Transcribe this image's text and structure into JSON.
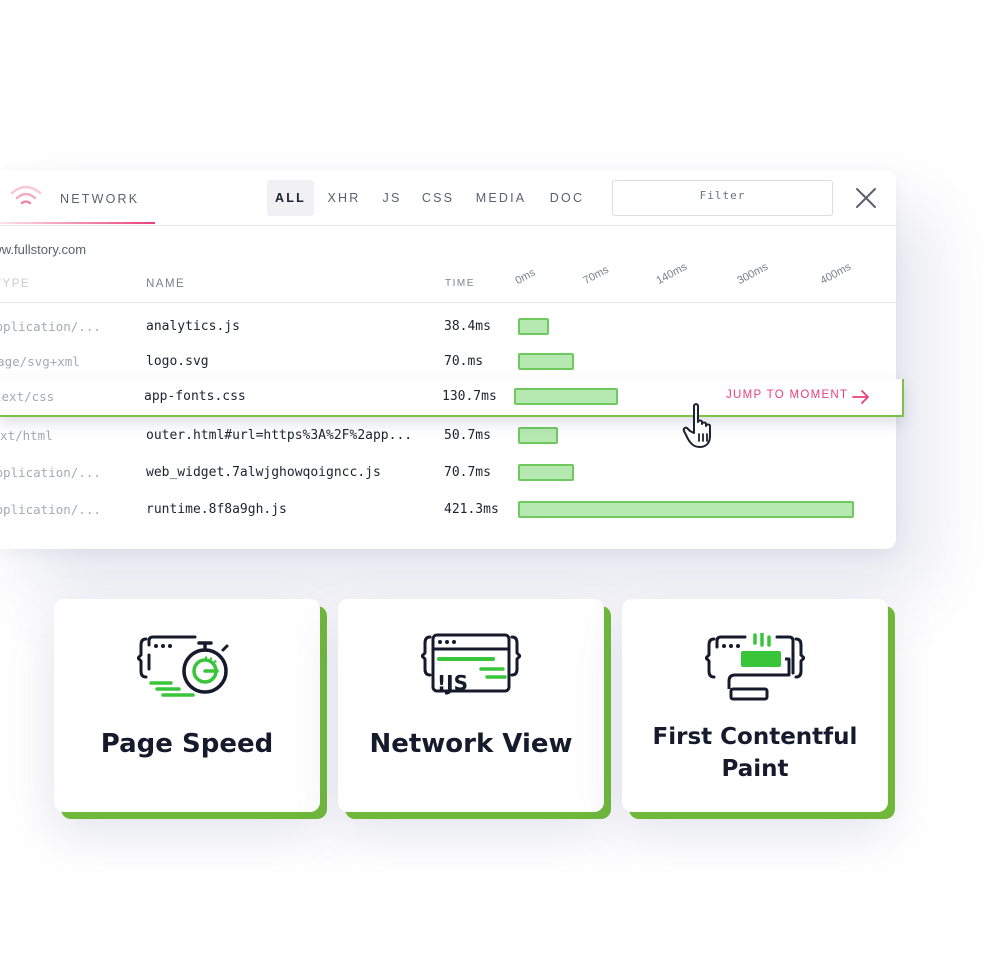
{
  "colors": {
    "accent_pink": "#e8407a",
    "bar_fill": "#b6e8b2",
    "bar_stroke": "#6fca5e",
    "card_shadow": "#6fb83a"
  },
  "network_panel": {
    "title": "NETWORK",
    "icon": "wifi-icon",
    "filter_tabs": [
      "ALL",
      "XHR",
      "JS",
      "CSS",
      "MEDIA",
      "DOC"
    ],
    "active_tab": "ALL",
    "filter_label": "Filter",
    "domain": "www.fullstory.com",
    "columns": {
      "type": "TYPE",
      "name": "NAME",
      "time": "TIME"
    },
    "timeline_ticks": [
      "0ms",
      "70ms",
      "140ms",
      "300ms",
      "400ms"
    ],
    "rows": [
      {
        "type": "application/...",
        "name": "analytics.js",
        "time": "38.4ms",
        "duration_ms": 38.4
      },
      {
        "type": "image/svg+xml",
        "name": "logo.svg",
        "time": "70.ms",
        "duration_ms": 70
      },
      {
        "type": "text/css",
        "name": "app-fonts.css",
        "time": "130.7ms",
        "duration_ms": 130.7
      },
      {
        "type": "text/html",
        "name": "outer.html#url=https%3A%2F%2app...",
        "time": "50.7ms",
        "duration_ms": 50.7
      },
      {
        "type": "application/...",
        "name": "web_widget.7alwjghowqoigncc.js",
        "time": "70.7ms",
        "duration_ms": 70.7
      },
      {
        "type": "application/...",
        "name": "runtime.8f8a9gh.js",
        "time": "421.3ms",
        "duration_ms": 421.3
      }
    ],
    "jump_label": "JUMP TO MOMENT"
  },
  "cards": [
    {
      "title": "Page Speed",
      "icon": "stopwatch-code-icon"
    },
    {
      "title": "Network View",
      "icon": "js-code-icon"
    },
    {
      "title": "First Contentful Paint",
      "icon": "paint-roller-code-icon"
    }
  ]
}
